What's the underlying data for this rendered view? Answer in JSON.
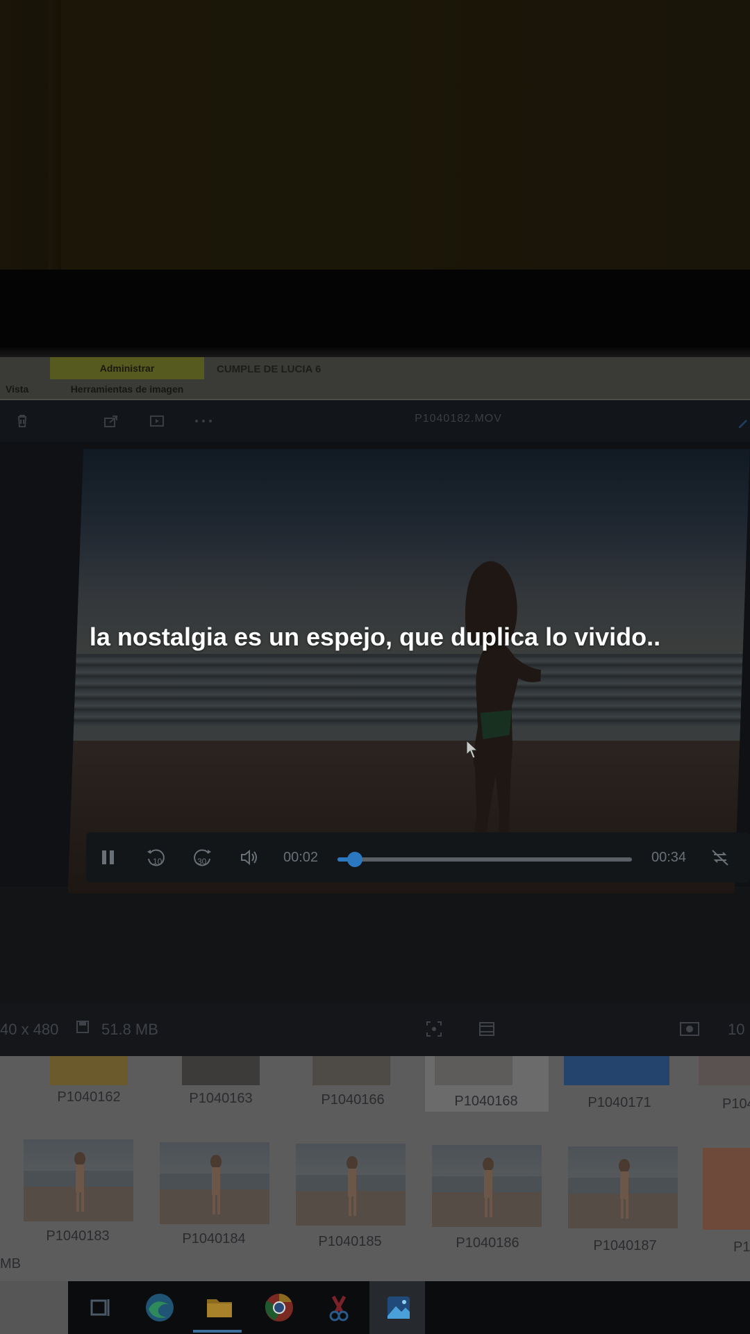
{
  "caption": "la nostalgia es un espejo, que duplica lo vivido..",
  "ribbon": {
    "manage_label": "Administrar",
    "tools_label": "Herramientas de imagen",
    "view_label": "Vista",
    "folder_title": "CUMPLE DE LUCIA 6"
  },
  "app": {
    "file_name": "P1040182.MOV"
  },
  "player": {
    "current_time": "00:02",
    "total_time": "00:34",
    "progress": 0.059,
    "rewind_label": "10",
    "forward_label": "30"
  },
  "status": {
    "dimensions": "40 x 480",
    "size": "51.8 MB",
    "zoom": "10"
  },
  "thumbnails_row1": [
    "P1040162",
    "P1040163",
    "P1040166",
    "P1040168",
    "P1040171",
    "P104"
  ],
  "thumbnails_row2": [
    "P1040183",
    "P1040184",
    "P1040185",
    "P1040186",
    "P1040187",
    "P1"
  ],
  "left_edge_text": "MB",
  "colors": {
    "accent": "#2b78c0",
    "ribbon_manage": "#575a1e"
  }
}
